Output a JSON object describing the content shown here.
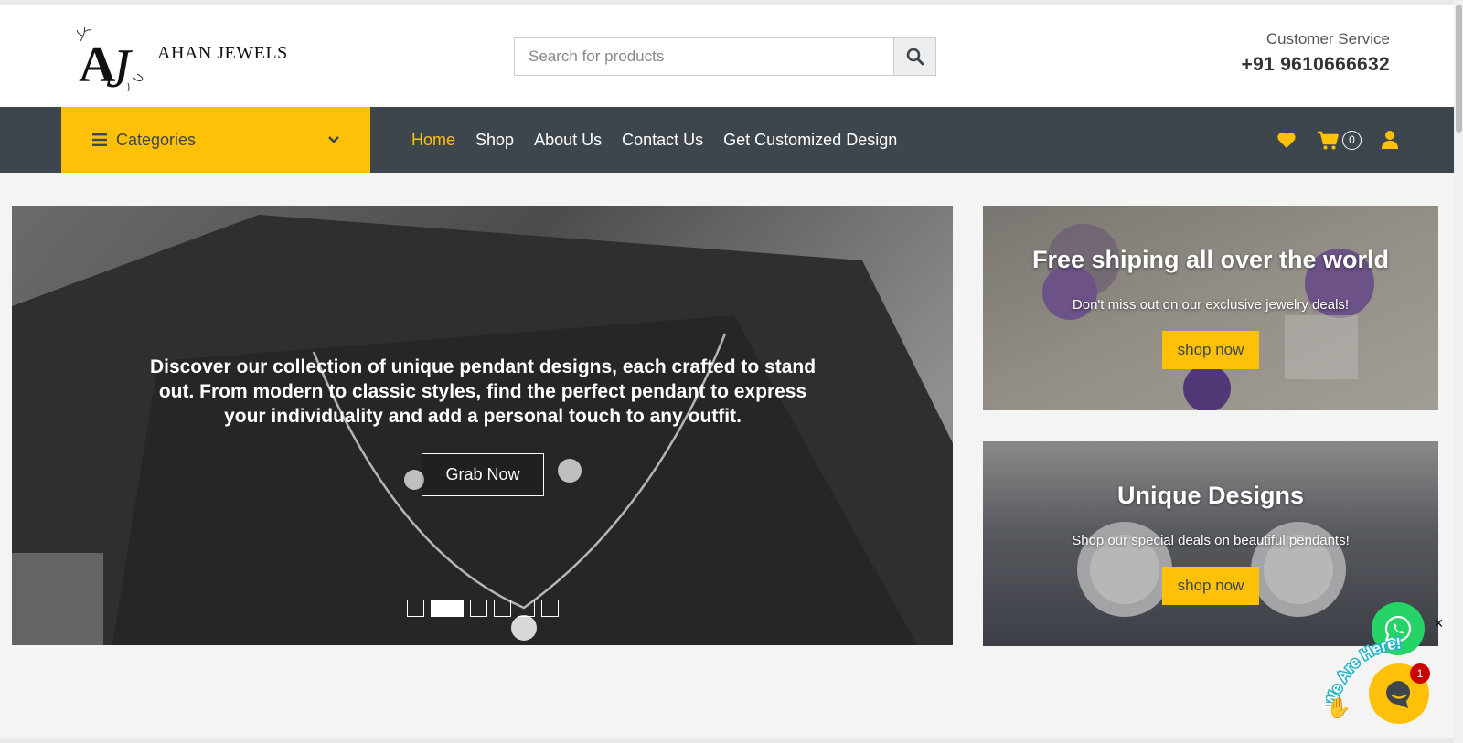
{
  "brand": {
    "name": "AHAN JEWELS",
    "monogram": "AJ"
  },
  "search": {
    "placeholder": "Search for products",
    "value": ""
  },
  "service": {
    "label": "Customer Service",
    "phone": "+91 9610666632"
  },
  "nav": {
    "categories_label": "Categories",
    "links": [
      {
        "label": "Home",
        "active": true
      },
      {
        "label": "Shop",
        "active": false
      },
      {
        "label": "About Us",
        "active": false
      },
      {
        "label": "Contact Us",
        "active": false
      },
      {
        "label": "Get Customized Design",
        "active": false
      }
    ],
    "cart_count": "0"
  },
  "hero": {
    "text": "Discover our collection of unique pendant designs, each crafted to stand out. From modern to classic styles, find the perfect pendant to express your individuality and add a personal touch to any outfit.",
    "button": "Grab Now",
    "slide_count": 6,
    "active_slide": 2
  },
  "promos": [
    {
      "title": "Free shiping all over the world",
      "subtitle": "Don't miss out on our exclusive jewelry deals!",
      "button": "shop now"
    },
    {
      "title": "Unique Designs",
      "subtitle": "Shop our special deals on beautiful pendants!",
      "button": "shop now"
    }
  ],
  "widgets": {
    "close": "×",
    "chat_badge": "1",
    "tagline": "We Are Here!"
  },
  "colors": {
    "accent": "#ffc107",
    "navbar": "#3d464d",
    "whatsapp": "#25d366"
  },
  "icons": [
    "bars-icon",
    "chevron-down-icon",
    "search-icon",
    "heart-icon",
    "cart-icon",
    "user-icon",
    "whatsapp-icon",
    "chat-icon"
  ]
}
